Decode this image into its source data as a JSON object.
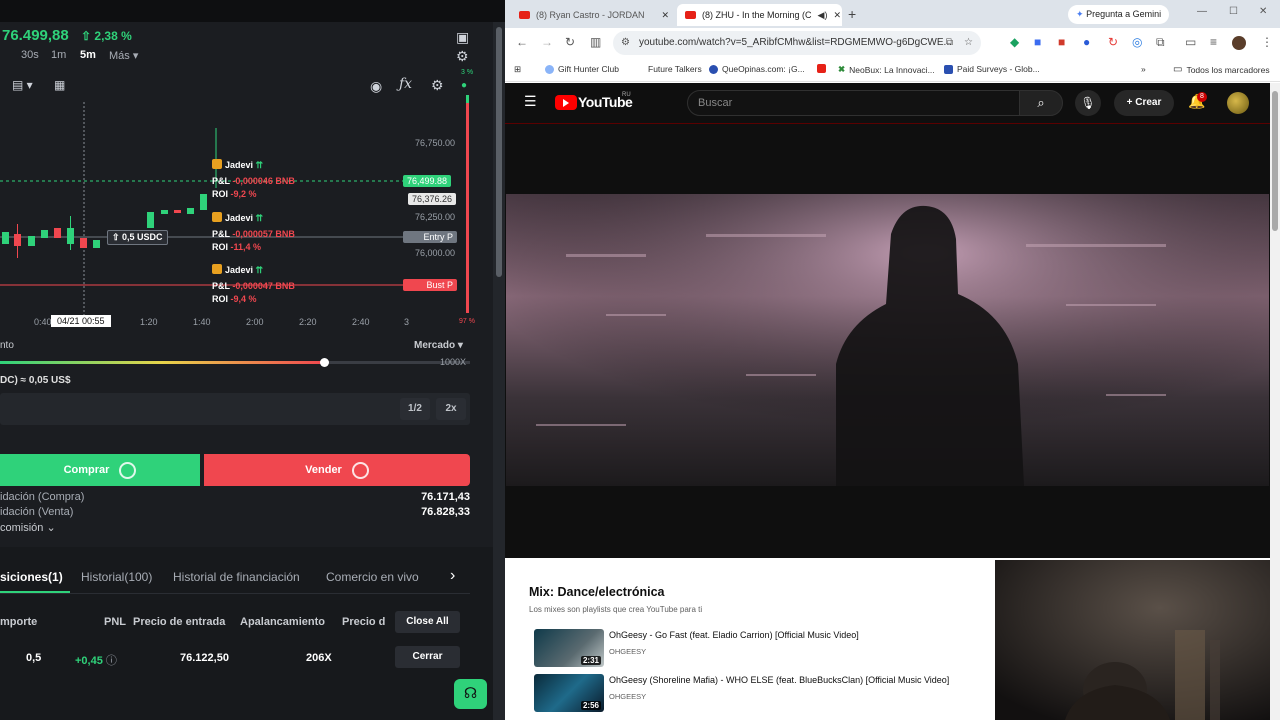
{
  "trading": {
    "price": "76.499,88",
    "change": "2,38 %",
    "timeframes": [
      "30s",
      "1m",
      "5m",
      "Más"
    ],
    "active_timeframe": "5m",
    "y_labels": [
      "76,750.00",
      "76,250.00",
      "76,000.00"
    ],
    "current_price_tag": "76,499.88",
    "second_price_tag": "76,376.26",
    "entry_tag": "Entry P",
    "bust_tag": "Bust P",
    "top_pct": "3 %",
    "bottom_pct": "97 %",
    "x_labels": [
      "0:40",
      "1:20",
      "1:40",
      "2:00",
      "2:20",
      "2:40",
      "3"
    ],
    "crosshair_time": "04/21 00:55",
    "position_tag": "0,5 USDC",
    "annotations": [
      {
        "name": "Jadevi",
        "pnl_label": "P&L",
        "pnl": "-0,000046 BNB",
        "roi_label": "ROI",
        "roi": "-9,2 %"
      },
      {
        "name": "Jadevi",
        "pnl_label": "P&L",
        "pnl": "-0,000057 BNB",
        "roi_label": "ROI",
        "roi": "-11,4 %"
      },
      {
        "name": "Jadevi",
        "pnl_label": "P&L",
        "pnl": "-0,000047 BNB",
        "roi_label": "ROI",
        "roi": "-9,4 %"
      }
    ],
    "leverage_section": "nto",
    "order_type": "Mercado",
    "max_leverage": "1000X",
    "leverage_fraction": 0.69,
    "amount_line": "DC) ≈ 0,05 US$",
    "half_button": "1/2",
    "double_button": "2x",
    "buy_label": "Comprar",
    "sell_label": "Vender",
    "liq_buy_label": "idación (Compra)",
    "liq_buy_value": "76.171,43",
    "liq_sell_label": "idación (Venta)",
    "liq_sell_value": "76.828,33",
    "commission_label": "comisión",
    "tabs": [
      "siciones(1)",
      "Historial(100)",
      "Historial de financiación",
      "Comercio en vivo"
    ],
    "columns": [
      "mporte",
      "PNL",
      "Precio de entrada",
      "Apalancamiento",
      "Precio d"
    ],
    "close_all": "Close All",
    "row": {
      "amount": "0,5",
      "pnl": "+0,45",
      "entry": "76.122,50",
      "leverage": "206X",
      "close": "Cerrar"
    }
  },
  "browser": {
    "tabs": [
      {
        "title": "(8) Ryan Castro - JORDAN"
      },
      {
        "title": "(8) ZHU - In the Morning (C"
      }
    ],
    "gemini": "Pregunta a Gemini",
    "url": "youtube.com/watch?v=5_ARibfCMhw&list=RDGMEMWO-g6DgCWE...",
    "bookmarks": [
      "Gift Hunter Club",
      "Future Talkers",
      "QueOpinas.com: ¡G...",
      "NeoBux: La Innovaci...",
      "Paid Surveys - Glob...",
      "Todos los marcadores"
    ]
  },
  "youtube": {
    "logo": "YouTube",
    "region": "RU",
    "search_placeholder": "Buscar",
    "create": "Crear",
    "notifications": "8",
    "mix_title": "Mix: Dance/electrónica",
    "mix_subtitle": "Los mixes son playlists que crea YouTube para ti",
    "items": [
      {
        "title": "OhGeesy - Go Fast (feat. Eladio Carrion) [Official Music Video]",
        "channel": "OHGEESY",
        "duration": "2:31"
      },
      {
        "title": "OhGeesy (Shoreline Mafia) - WHO ELSE (feat. BlueBucksClan) [Official Music Video]",
        "channel": "OHGEESY",
        "duration": "2:56"
      }
    ]
  },
  "colors": {
    "up": "#2fd27a",
    "down": "#f0474f",
    "youtube_red": "#ff0000"
  }
}
